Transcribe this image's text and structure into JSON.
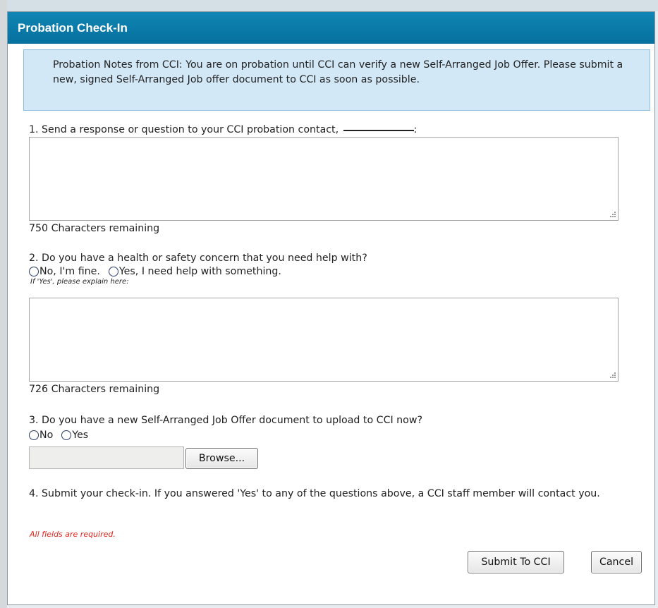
{
  "dialog": {
    "title": "Probation Check-In"
  },
  "notes": {
    "text": "Probation Notes from CCI:  You are on probation until CCI can verify a new Self-Arranged Job Offer. Please submit a new, signed Self-Arranged Job offer document to CCI as soon as possible."
  },
  "question1": {
    "label": "1. Send a response or question to your CCI probation contact,",
    "suffix": ":",
    "response_value": "",
    "chars_remaining": "750 Characters remaining"
  },
  "question2": {
    "label": "2. Do you have a health or safety concern that you need help with?",
    "options": [
      "No, I'm fine.",
      "Yes, I need help with something."
    ],
    "hint": "If 'Yes', please explain here:",
    "explain_value": "",
    "chars_remaining": "726 Characters remaining"
  },
  "question3": {
    "label": "3. Do you have a new Self-Arranged Job Offer document to upload to CCI now?",
    "options": [
      "No",
      "Yes"
    ],
    "file_value": "",
    "browse_label": "Browse..."
  },
  "question4": {
    "label": "4. Submit your check-in. If you answered 'Yes' to any of the questions above, a CCI staff member will contact you."
  },
  "footer": {
    "required_note": "All fields are required.",
    "submit_label": "Submit To CCI",
    "cancel_label": "Cancel"
  },
  "colors": {
    "titlebar": "#0a77a4",
    "notes_background": "#d2e8f7",
    "required_text": "#e0241b"
  }
}
